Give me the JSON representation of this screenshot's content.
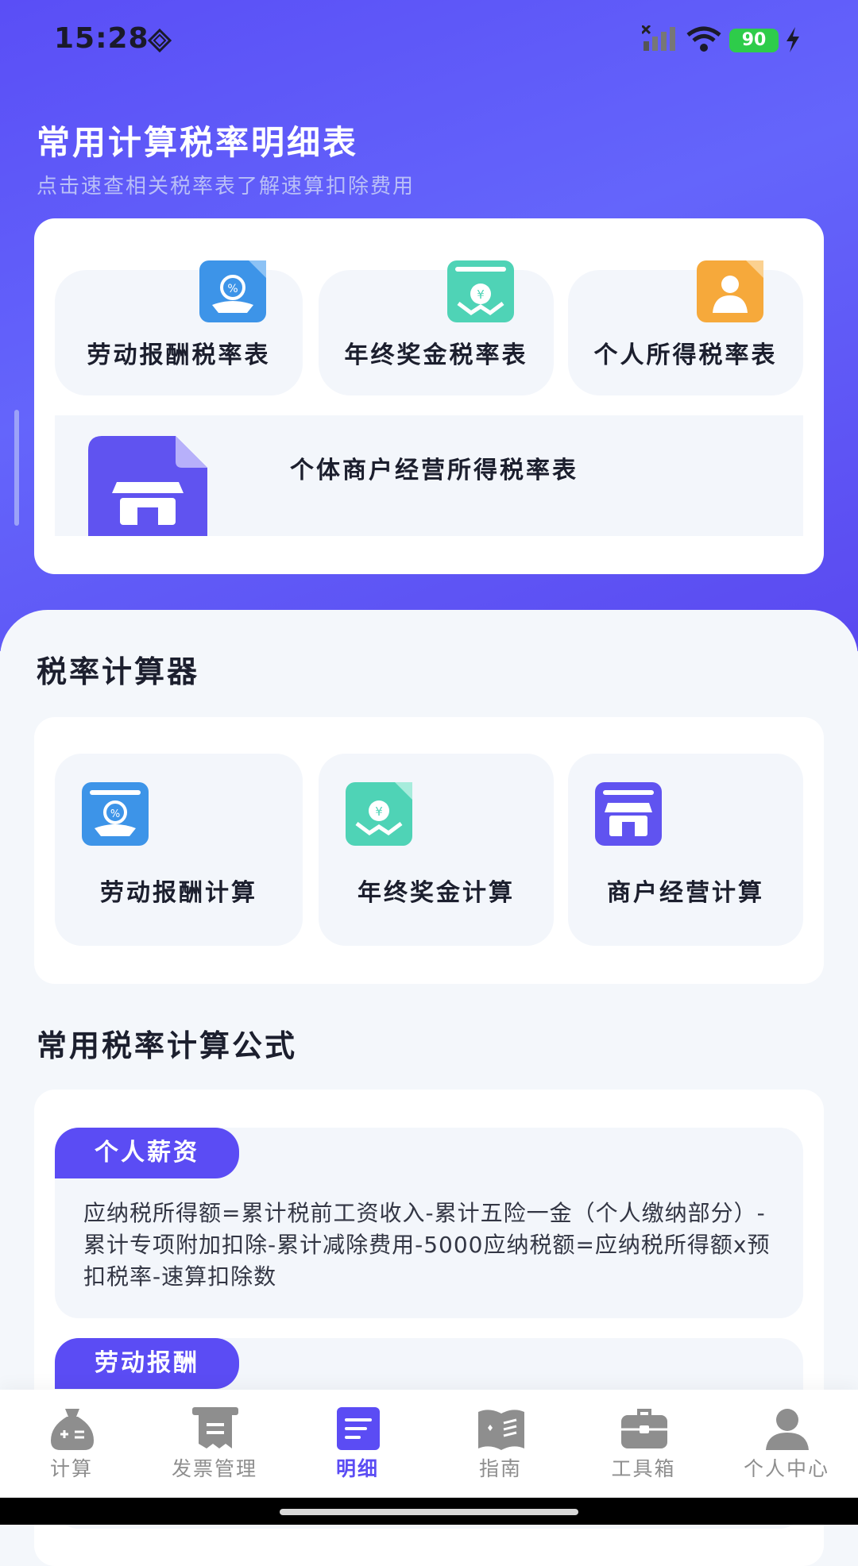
{
  "status": {
    "time": "15:28",
    "battery": "90"
  },
  "hero": {
    "title": "常用计算税率明细表",
    "subtitle": "点击速查相关税率表了解速算扣除费用"
  },
  "rate_tables": [
    {
      "label": "劳动报酬税率表",
      "icon": "labor-percent-icon"
    },
    {
      "label": "年终奖金税率表",
      "icon": "bonus-yen-icon"
    },
    {
      "label": "个人所得税率表",
      "icon": "personal-user-icon"
    },
    {
      "label": "个体商户经营所得税率表",
      "icon": "shop-store-icon"
    }
  ],
  "calculator": {
    "title": "税率计算器",
    "items": [
      {
        "label": "劳动报酬计算",
        "icon": "labor-percent-icon"
      },
      {
        "label": "年终奖金计算",
        "icon": "bonus-yen-icon"
      },
      {
        "label": "商户经营计算",
        "icon": "shop-store-icon"
      }
    ]
  },
  "formulas": {
    "title": "常用税率计算公式",
    "items": [
      {
        "tag": "个人薪资",
        "text": "应纳税所得额=累计税前工资收入-累计五险一金（个人缴纳部分）-累计专项附加扣除-累计减除费用-5000应纳税额=应纳税所得额x预扣税率-速算扣除数"
      },
      {
        "tag": "劳动报酬",
        "text": ""
      }
    ]
  },
  "tabbar": {
    "active": "明细",
    "items": [
      {
        "label": "计算",
        "icon": "calculator-bag-icon"
      },
      {
        "label": "发票管理",
        "icon": "invoice-icon"
      },
      {
        "label": "明细",
        "icon": "detail-list-icon"
      },
      {
        "label": "指南",
        "icon": "guide-book-icon"
      },
      {
        "label": "工具箱",
        "icon": "toolbox-icon"
      },
      {
        "label": "个人中心",
        "icon": "user-center-icon"
      }
    ]
  },
  "colors": {
    "accent": "#5b4cf4",
    "hero_bg": "#6162fa",
    "blue_icon": "#3d94e8",
    "green_icon": "#4fd3b6",
    "orange_icon": "#f6a93b",
    "purple_icon": "#6053f0"
  }
}
